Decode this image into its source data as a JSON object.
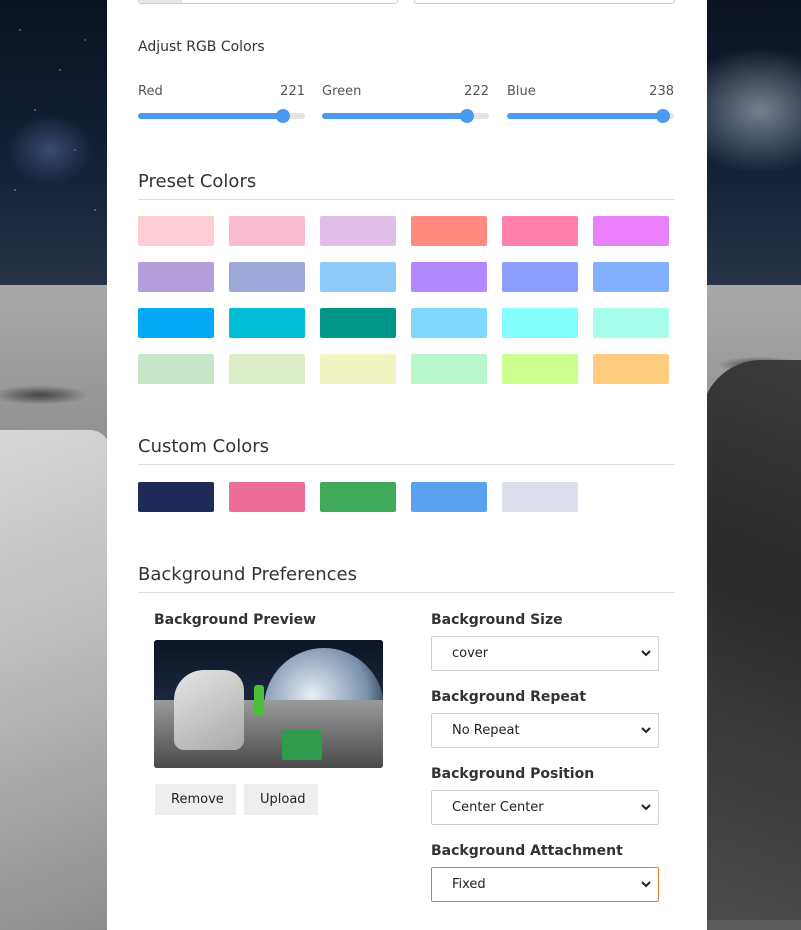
{
  "rgb": {
    "title": "Adjust RGB Colors",
    "sliders": [
      {
        "label": "Red",
        "value": 221
      },
      {
        "label": "Green",
        "value": 222
      },
      {
        "label": "Blue",
        "value": 238
      }
    ]
  },
  "preset": {
    "title": "Preset Colors",
    "colors": [
      "#ffcdd2",
      "#f8bbd0",
      "#e1bee7",
      "#ff8a80",
      "#ff80ab",
      "#ea80fc",
      "#b39ddb",
      "#9fa8da",
      "#90caf9",
      "#b388ff",
      "#8c9eff",
      "#82b1ff",
      "#03a9f4",
      "#00bcd4",
      "#009688",
      "#80d8ff",
      "#84ffff",
      "#a7ffeb",
      "#c8e6c9",
      "#dcedc8",
      "#f0f4c3",
      "#b9f6ca",
      "#ccff90",
      "#ffcc80"
    ]
  },
  "custom": {
    "title": "Custom Colors",
    "colors": [
      "#1f2a5a",
      "#ee6e9a",
      "#3faa5a",
      "#5aa2f0",
      "#dde0ec"
    ]
  },
  "bg": {
    "title": "Background Preferences",
    "preview_label": "Background Preview",
    "remove_label": "Remove",
    "upload_label": "Upload",
    "size_label": "Background Size",
    "size_value": "cover",
    "repeat_label": "Background Repeat",
    "repeat_value": "No Repeat",
    "position_label": "Background Position",
    "position_value": "Center Center",
    "attachment_label": "Background Attachment",
    "attachment_value": "Fixed"
  },
  "accent": "#4a9bf0"
}
